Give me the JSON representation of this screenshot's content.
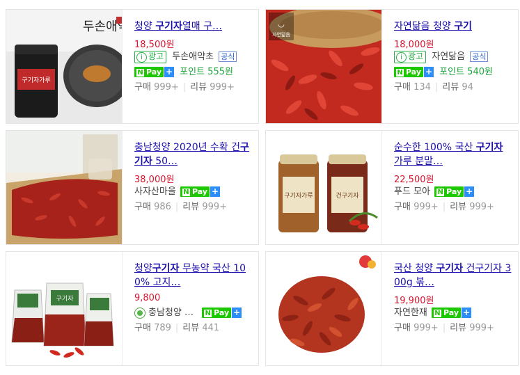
{
  "products": [
    {
      "title_parts": [
        {
          "t": "청양 ",
          "b": false
        },
        {
          "t": "구기자",
          "b": true
        },
        {
          "t": "열매 구…",
          "b": false
        }
      ],
      "price": "18,500원",
      "ad_label": "광고",
      "seller": "두손애약초",
      "official": "공식",
      "pay_label": "Pay",
      "points": "포인트 555원",
      "buy_label": "구매",
      "buy_count": "999+",
      "review_label": "리뷰",
      "review_count": "999+",
      "image_text": "두손애약초"
    },
    {
      "title_parts": [
        {
          "t": "자연닮음 청양 ",
          "b": false
        },
        {
          "t": "구기",
          "b": true
        }
      ],
      "price": "18,000원",
      "ad_label": "광고",
      "seller": "자연닮음",
      "official": "공식",
      "pay_label": "Pay",
      "points": "포인트 540원",
      "buy_label": "구매",
      "buy_count": "134",
      "review_label": "리뷰",
      "review_count": "94",
      "image_text": "자연닮음"
    },
    {
      "title_parts": [
        {
          "t": "충남청양 2020년 수확 건",
          "b": false
        },
        {
          "t": "구기자",
          "b": true
        },
        {
          "t": " 50…",
          "b": false
        }
      ],
      "price": "38,000원",
      "seller": "사자산마을",
      "pay_label": "Pay",
      "buy_label": "구매",
      "buy_count": "986",
      "review_label": "리뷰",
      "review_count": "999+"
    },
    {
      "title_parts": [
        {
          "t": "순수한 100% 국산 ",
          "b": false
        },
        {
          "t": "구기자",
          "b": true
        },
        {
          "t": " 가루 분말…",
          "b": false
        }
      ],
      "price": "22,500원",
      "seller": "푸드 모아",
      "pay_label": "Pay",
      "buy_label": "구매",
      "buy_count": "999+",
      "review_label": "리뷰",
      "review_count": "999+",
      "jar_label_1": "구기자가루",
      "jar_label_2": "건구기자"
    },
    {
      "title_parts": [
        {
          "t": "청양",
          "b": false
        },
        {
          "t": "구기자",
          "b": true
        },
        {
          "t": " 무농약 국산 100% 고지…",
          "b": false
        }
      ],
      "price": "9,800",
      "seller": "충남청양 …",
      "pay_label": "Pay",
      "buy_label": "구매",
      "buy_count": "789",
      "review_label": "리뷰",
      "review_count": "441",
      "bag_label": "구기자"
    },
    {
      "title_parts": [
        {
          "t": "국산 청양 ",
          "b": false
        },
        {
          "t": "구기자",
          "b": true
        },
        {
          "t": " 건구기자 300g 볶…",
          "b": false
        }
      ],
      "price": "19,900원",
      "seller": "자연한재",
      "pay_label": "Pay",
      "buy_label": "구매",
      "buy_count": "999+",
      "review_label": "리뷰",
      "review_count": "999+"
    }
  ],
  "colors": {
    "title": "#1a0dab",
    "price": "#d6142e",
    "npay": "#1ec800",
    "points": "#1ea43c"
  }
}
